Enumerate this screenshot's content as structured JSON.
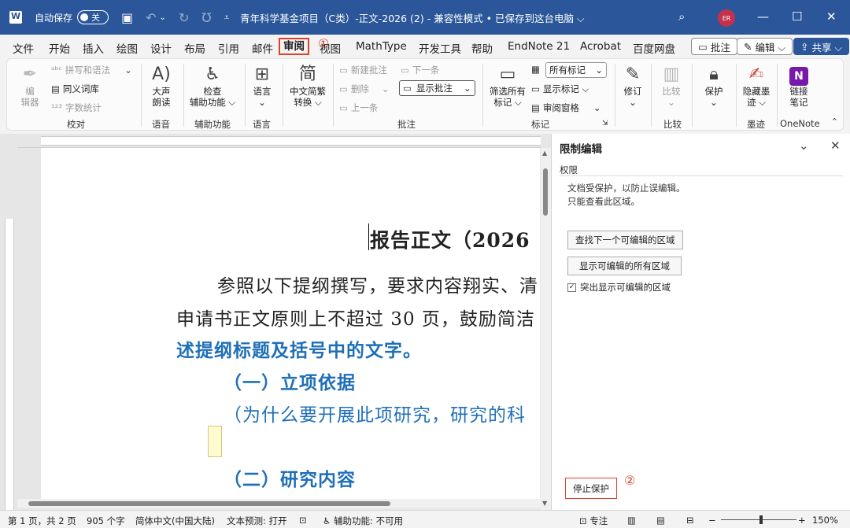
{
  "titlebar": {
    "autosave_label": "自动保存",
    "autosave_state": "关",
    "doc_title": "青年科学基金项目（C类）-正文-2026 (2)  -  兼容性模式 • 已保存到这台电脑 ⌵",
    "avatar": "ER",
    "icons": [
      "word-icon",
      "save-icon",
      "undo-icon",
      "redo-icon",
      "repeat-icon",
      "customize-icon",
      "search-icon",
      "minimize-icon",
      "maximize-icon",
      "close-icon"
    ]
  },
  "menu": {
    "tabs": [
      "文件",
      "开始",
      "插入",
      "绘图",
      "设计",
      "布局",
      "引用",
      "邮件",
      "审阅",
      "视图",
      "MathType",
      "开发工具",
      "帮助",
      "EndNote 21",
      "Acrobat",
      "百度网盘"
    ],
    "active_tab": "审阅",
    "annotation_1": "①",
    "comments_btn": "批注",
    "edit_btn": "编辑 ⌵",
    "share_btn": "共享 ⌵"
  },
  "ribbon": {
    "proofing": {
      "label": "校对",
      "edit_btn": "编\n辑器",
      "spell": "拼写和语法",
      "thesaurus": "同义词库",
      "wordcount": "字数统计"
    },
    "speech": {
      "label": "语音",
      "read_aloud_1": "大声",
      "read_aloud_2": "朗读"
    },
    "accessibility": {
      "label": "辅助功能",
      "check_1": "检查",
      "check_2": "辅助功能 ⌵"
    },
    "language": {
      "label": "语言",
      "btn": "语言"
    },
    "chinese": {
      "conv_1": "中文简繁",
      "conv_2": "转换 ⌵"
    },
    "comments": {
      "label": "批注",
      "new": "新建批注",
      "delete": "删除",
      "previous": "上一条",
      "next": "下一条",
      "show": "显示批注"
    },
    "tracking": {
      "label": "标记",
      "filter_1": "筛选所有",
      "filter_2": "标记 ⌵",
      "all_markup": "所有标记",
      "show_markup": "显示标记 ⌵",
      "review_pane": "审阅窗格"
    },
    "changes": {
      "revise": "修订"
    },
    "compare": {
      "label": "比较",
      "btn": "比较"
    },
    "protect": {
      "btn": "保护"
    },
    "ink": {
      "label": "墨迹",
      "hide_1": "隐藏墨",
      "hide_2": "迹 ⌵"
    },
    "onenote": {
      "label": "OneNote",
      "link_1": "链接",
      "link_2": "笔记",
      "icon_letter": "N"
    }
  },
  "document": {
    "title_line": "报告正文（2026",
    "para1_line1": "参照以下提纲撰写，要求内容翔实、清",
    "para1_line2": "申请书正文原则上不超过 30 页，鼓励简洁",
    "para1_line3": "述提纲标题及括号中的文字。",
    "section1": "（一）立项依据",
    "section1_note": "（为什么要开展此项研究，研究的科",
    "section2": "（二）研究内容"
  },
  "pane": {
    "title": "限制编辑",
    "subtitle": "权限",
    "desc_1": "文档受保护，以防止误编辑。",
    "desc_2": "只能查看此区域。",
    "find_next_btn": "查找下一个可编辑的区域",
    "show_all_btn": "显示可编辑的所有区域",
    "highlight_label": "突出显示可编辑的区域",
    "highlight_checked": "✓",
    "stop_btn": "停止保护",
    "annotation_2": "②"
  },
  "status": {
    "page": "第 1 页，共 2 页",
    "words": "905 个字",
    "lang": "简体中文(中国大陆)",
    "predict": "文本预测: 打开",
    "access": "辅助功能: 不可用",
    "focus": "专注",
    "zoom_minus": "−",
    "zoom_plus": "+",
    "zoom": "150%"
  },
  "colors": {
    "titlebar": "#2b579a",
    "accent_red": "#e0402a",
    "doc_blue": "#1f6fb8"
  }
}
